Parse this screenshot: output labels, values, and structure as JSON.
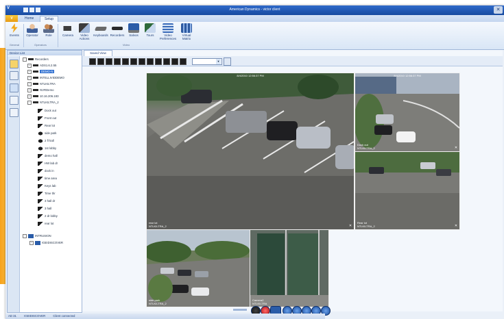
{
  "app": {
    "title": "American Dynamics - victor client",
    "logo_text": "V",
    "menu_label": "V"
  },
  "ribbon": {
    "tabs": [
      {
        "label": "Home"
      },
      {
        "label": "Setup"
      }
    ],
    "buttons": [
      {
        "label": "Events",
        "icon": "lightning-icon",
        "color": "#f2a81d"
      },
      {
        "label": "Operator",
        "icon": "operator-icon",
        "color": "#c98a55"
      },
      {
        "label": "Role",
        "icon": "role-icon",
        "color": "#8a5a3a"
      },
      {
        "label": "Camera",
        "icon": "camera-icon",
        "color": "#3c3c3c"
      },
      {
        "label": "Video Actions",
        "icon": "video-actions-icon",
        "color": "#3c3c3c"
      },
      {
        "label": "Keyboards",
        "icon": "keyboard-icon",
        "color": "#6a6a6a"
      },
      {
        "label": "Recorders",
        "icon": "recorder-icon",
        "color": "#2a2a2a"
      },
      {
        "label": "Salvos",
        "icon": "salvo-icon",
        "color": "#2a5ca8"
      },
      {
        "label": "Tours",
        "icon": "tour-icon",
        "color": "#2e6a3a"
      },
      {
        "label": "Video Preferences",
        "icon": "video-preferences-icon",
        "color": "#3a6bb8"
      },
      {
        "label": "Virtual Matrix",
        "icon": "virtual-matrix-icon",
        "color": "#2e5aa0"
      }
    ],
    "groups": [
      {
        "label": "General"
      },
      {
        "label": "Operators"
      },
      {
        "label": "Video"
      }
    ]
  },
  "device_panel": {
    "title": "Device List",
    "tree": [
      {
        "label": "Recorders",
        "level": 0,
        "icon": "recorder-icon"
      },
      {
        "label": "ADS1.6.2.55",
        "level": 1,
        "icon": "recorder-icon"
      },
      {
        "label": "DEMO-N",
        "level": 1,
        "icon": "recorder-icon",
        "selected": true
      },
      {
        "label": "INTELLIVIDDEMO",
        "level": 1,
        "icon": "recorder-icon"
      },
      {
        "label": "NTLKILTRA",
        "level": 1,
        "icon": "recorder-icon"
      },
      {
        "label": "NVRDemo",
        "level": 1,
        "icon": "recorder-icon"
      },
      {
        "label": "10.16.206.183",
        "level": 1,
        "icon": "recorder-icon"
      },
      {
        "label": "NTLKILTRA_2",
        "level": 1,
        "icon": "recorder-icon"
      },
      {
        "label": "Dock out",
        "level": 2,
        "icon": "camera-icon"
      },
      {
        "label": "Front out",
        "level": 2,
        "icon": "camera-icon"
      },
      {
        "label": "Rear lot",
        "level": 2,
        "icon": "camera-icon"
      },
      {
        "label": "side park",
        "level": 2,
        "icon": "dome-camera-icon"
      },
      {
        "label": "2 fl hall",
        "level": 2,
        "icon": "dome-camera-icon"
      },
      {
        "label": "1st lobby",
        "level": 2,
        "icon": "dome-camera-icon"
      },
      {
        "label": "demo hall",
        "level": 2,
        "icon": "camera-icon"
      },
      {
        "label": "HW lab dr",
        "level": 2,
        "icon": "camera-icon"
      },
      {
        "label": "dock in",
        "level": 2,
        "icon": "camera-icon"
      },
      {
        "label": "time area",
        "level": 2,
        "icon": "camera-icon"
      },
      {
        "label": "Keys lab",
        "level": 2,
        "icon": "camera-icon"
      },
      {
        "label": "Time thr",
        "level": 2,
        "icon": "camera-icon"
      },
      {
        "label": "3 hall dr",
        "level": 2,
        "icon": "camera-icon"
      },
      {
        "label": "3 hall",
        "level": 2,
        "icon": "camera-icon"
      },
      {
        "label": "2 dr lobby",
        "level": 2,
        "icon": "camera-icon"
      },
      {
        "label": "rear lot",
        "level": 2,
        "icon": "camera-icon"
      },
      {
        "label": "INTRUSION",
        "level": 0,
        "icon": "intrusion-icon"
      },
      {
        "label": "IGEIDISCOVER",
        "level": 1,
        "icon": "intrusion-icon"
      }
    ]
  },
  "main": {
    "tab_label": "Saved View",
    "layout_combo_value": "",
    "tiles": [
      {
        "timestamp": "8/4/2010 12:56:37 PM",
        "camera": "rear lot",
        "recorder": "NTLKILTRA_2"
      },
      {
        "timestamp": "8/4/2010 12:56:37 PM",
        "camera": "Dock out",
        "recorder": "NTLKILTRA_2"
      },
      {
        "timestamp": "",
        "camera": "Rear lot",
        "recorder": "NTLKILTRA_2"
      },
      {
        "timestamp": "",
        "camera": "side park",
        "recorder": "NTLKILTRA_2"
      },
      {
        "timestamp": "",
        "camera": "Camera2",
        "recorder": "NTLKILTRA"
      }
    ]
  },
  "statusbar": {
    "items": [
      "AD 31",
      "IGEIDISCOVER",
      "Client connected"
    ]
  },
  "colors": {
    "titlebar": "#1f57b5",
    "ribbon": "#dbe6f6",
    "accent_orange": "#f7a21b",
    "selection": "#2f6fd0"
  }
}
